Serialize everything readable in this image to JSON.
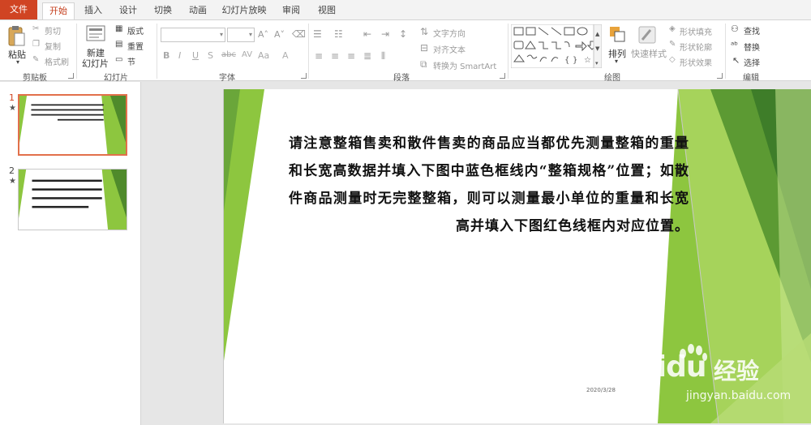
{
  "tabs": [
    "文件",
    "开始",
    "插入",
    "设计",
    "切换",
    "动画",
    "幻灯片放映",
    "审阅",
    "视图"
  ],
  "active_tab": "开始",
  "ribbon": {
    "clipboard": {
      "paste": "粘贴",
      "cut": "剪切",
      "copy": "复制",
      "format_painter": "格式刷",
      "label": "剪贴板"
    },
    "slides": {
      "new_slide_line1": "新建",
      "new_slide_line2": "幻灯片",
      "layout": "版式",
      "reset": "重置",
      "section": "节",
      "label": "幻灯片"
    },
    "font": {
      "label": "字体",
      "font_name": "",
      "font_size": ""
    },
    "paragraph": {
      "text_direction": "文字方向",
      "align_text": "对齐文本",
      "smartart": "转换为 SmartArt",
      "label": "段落"
    },
    "drawing": {
      "arrange": "排列",
      "quick_styles": "快速样式",
      "shape_fill": "形状填充",
      "shape_outline": "形状轮廓",
      "shape_effects": "形状效果",
      "label": "绘图"
    },
    "editing": {
      "find": "查找",
      "replace": "替换",
      "select": "选择",
      "label": "编辑"
    }
  },
  "thumbnails": [
    {
      "number": "1",
      "star": "★",
      "selected": true
    },
    {
      "number": "2",
      "star": "★",
      "selected": false
    }
  ],
  "slide": {
    "body_text": "请注意整箱售卖和散件售卖的商品应当都优先测量整箱的重量和长宽高数据并填入下图中蓝色框线内“整箱规格”位置；如散件商品测量时无完整整箱，则可以测量最小单位的重量和长宽高并填入下图红色线框内对应位置。",
    "date": "2020/3/28"
  },
  "watermark": {
    "brand": "Baidu",
    "brand_cn": "经验",
    "url": "jingyan.baidu.com"
  },
  "colors": {
    "file_tab": "#d04423",
    "active_tab_text": "#c43e1c",
    "selection_border": "#e2704b",
    "green_light": "#8dc63f",
    "green_dark": "#4f8a2b"
  }
}
